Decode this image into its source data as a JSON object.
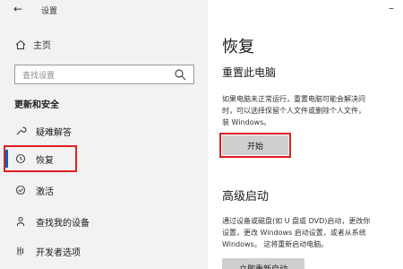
{
  "window": {
    "back": "←",
    "title": "设置",
    "minimize": "–"
  },
  "sidebar": {
    "home": "主页",
    "search_placeholder": "查找设置",
    "section": "更新和安全",
    "items": [
      {
        "label": "疑难解答",
        "icon": "wrench-icon"
      },
      {
        "label": "恢复",
        "icon": "history-icon"
      },
      {
        "label": "激活",
        "icon": "check-circle-icon"
      },
      {
        "label": "查找我的设备",
        "icon": "person-pin-icon"
      },
      {
        "label": "开发者选项",
        "icon": "developer-icon"
      }
    ]
  },
  "main": {
    "title": "恢复",
    "reset": {
      "heading": "重置此电脑",
      "description": "如果电脑未正常运行，重置电脑可能会解决问\n时，可以选择保留个人文件或删除个人文件，\n装 Windows。",
      "button": "开始"
    },
    "advanced": {
      "heading": "高级启动",
      "description": "通过设备或磁盘(如 U 盘或 DVD)启动，更改你\n设置，更改 Windows 启动设置，或者从系统\nWindows。 这将重新启动电脑。",
      "button": "立即重新启动"
    }
  },
  "colors": {
    "highlight": "#e02020",
    "sidebar_bg": "#f2f2f2",
    "button_bg": "#cfcfcf"
  }
}
